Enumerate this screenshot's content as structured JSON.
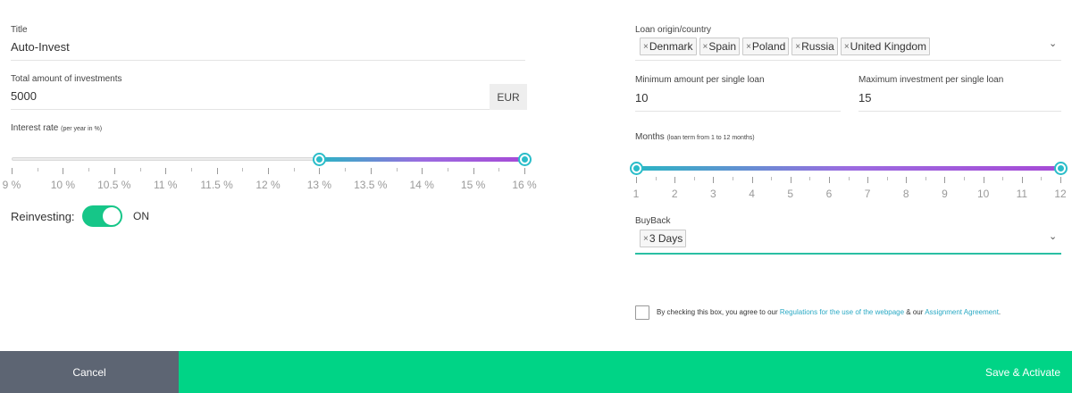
{
  "title_field": {
    "label": "Title",
    "value": "Auto-Invest"
  },
  "total_field": {
    "label": "Total amount of investments",
    "value": "5000",
    "currency": "EUR"
  },
  "interest": {
    "label": "Interest rate",
    "label_small": "(per year in %)",
    "ticks": [
      "9 %",
      "10 %",
      "10.5 %",
      "11 %",
      "11.5 %",
      "12 %",
      "13 %",
      "13.5 %",
      "14 %",
      "15 %",
      "16 %"
    ],
    "selected_min": "13 %",
    "selected_max": "16 %"
  },
  "reinvesting": {
    "label": "Reinvesting:",
    "state": "ON"
  },
  "loan_origin": {
    "label": "Loan origin/country",
    "chips": [
      "Denmark",
      "Spain",
      "Poland",
      "Russia",
      "United Kingdom"
    ],
    "chip_remove": "×",
    "chevron": "⌄"
  },
  "min_amount": {
    "label": "Minimum amount per single loan",
    "value": "10"
  },
  "max_investment": {
    "label": "Maximum investment per single loan",
    "value": "15"
  },
  "months": {
    "label": "Months",
    "label_small": "(loan term from 1 to 12 months)",
    "ticks": [
      "1",
      "2",
      "3",
      "4",
      "5",
      "6",
      "7",
      "8",
      "9",
      "10",
      "11",
      "12"
    ],
    "selected_min": "1",
    "selected_max": "12"
  },
  "buyback": {
    "label": "BuyBack",
    "chips": [
      "3 Days"
    ],
    "chip_remove": "×",
    "chevron": "⌄"
  },
  "agreement": {
    "text_before": "By checking this box, you agree to our ",
    "link1": "Regulations for the use of the webpage",
    "text_mid": " & our ",
    "link2": "Assignment Agreement",
    "text_after": "."
  },
  "footer": {
    "cancel_label": "Cancel",
    "save_label": "Save & Activate"
  },
  "colors": {
    "accent_green": "#00d486",
    "cancel_gray": "#5d6573",
    "slider_teal": "#2abdc9",
    "slider_purple": "#a64ad6",
    "link": "#2aa9c4"
  },
  "icons": {
    "chip_remove": "close-icon",
    "dropdown": "chevron-down-icon",
    "checkbox": "checkbox-icon"
  }
}
